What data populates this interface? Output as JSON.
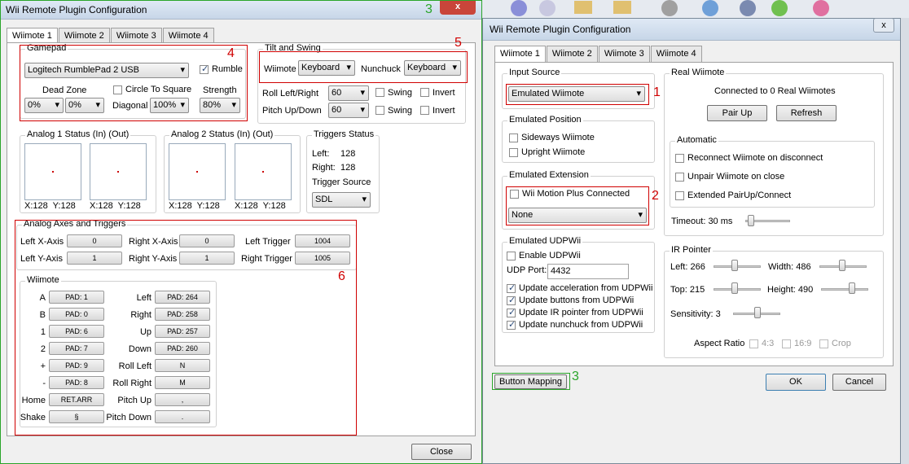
{
  "left_window": {
    "title": "Wii Remote Plugin Configuration",
    "close_glyph": "x",
    "tabs": [
      "Wiimote 1",
      "Wiimote 2",
      "Wiimote 3",
      "Wiimote 4"
    ],
    "gamepad": {
      "label": "Gamepad",
      "device": "Logitech RumblePad 2 USB",
      "rumble": "Rumble",
      "dead_zone": "Dead Zone",
      "dz1": "0%",
      "dz2": "0%",
      "circle_to_square": "Circle To Square",
      "diagonal": "Diagonal",
      "diagonal_value": "100%",
      "strength": "Strength",
      "strength_value": "80%"
    },
    "tilt": {
      "label": "Tilt and Swing",
      "wiimote": "Wiimote",
      "wiimote_value": "Keyboard",
      "nunchuck": "Nunchuck",
      "nunchuck_value": "Keyboard",
      "roll": "Roll Left/Right",
      "roll_value": "60",
      "pitch": "Pitch Up/Down",
      "pitch_value": "60",
      "swing": "Swing",
      "invert": "Invert"
    },
    "analog1": {
      "label": "Analog 1 Status (In) (Out)",
      "in": "X:128  Y:128",
      "out": "X:128  Y:128"
    },
    "analog2": {
      "label": "Analog 2 Status (In) (Out)",
      "in": "X:128  Y:128",
      "out": "X:128  Y:128"
    },
    "triggers": {
      "label": "Triggers Status",
      "left": "Left:",
      "left_value": "128",
      "right": "Right:",
      "right_value": "128",
      "source": "Trigger Source",
      "source_value": "SDL"
    },
    "axes": {
      "label": "Analog Axes and Triggers",
      "left_x": "Left X-Axis",
      "left_x_value": "0",
      "left_y": "Left Y-Axis",
      "left_y_value": "1",
      "right_x": "Right X-Axis",
      "right_x_value": "0",
      "right_y": "Right Y-Axis",
      "right_y_value": "1",
      "left_trigger": "Left Trigger",
      "left_trigger_value": "1004",
      "right_trigger": "Right Trigger",
      "right_trigger_value": "1005"
    },
    "wiimote": {
      "label": "Wiimote",
      "left_col": [
        {
          "label": "A",
          "value": "PAD: 1"
        },
        {
          "label": "B",
          "value": "PAD: 0"
        },
        {
          "label": "1",
          "value": "PAD: 6"
        },
        {
          "label": "2",
          "value": "PAD: 7"
        },
        {
          "label": "+",
          "value": "PAD: 9"
        },
        {
          "label": "-",
          "value": "PAD: 8"
        },
        {
          "label": "Home",
          "value": "RET.ARR"
        },
        {
          "label": "Shake",
          "value": "§"
        }
      ],
      "right_col": [
        {
          "label": "Left",
          "value": "PAD: 264"
        },
        {
          "label": "Right",
          "value": "PAD: 258"
        },
        {
          "label": "Up",
          "value": "PAD: 257"
        },
        {
          "label": "Down",
          "value": "PAD: 260"
        },
        {
          "label": "Roll Left",
          "value": "N"
        },
        {
          "label": "Roll Right",
          "value": "M"
        },
        {
          "label": "Pitch Up",
          "value": ","
        },
        {
          "label": "Pitch Down",
          "value": "."
        }
      ]
    },
    "close_button": "Close"
  },
  "right_window": {
    "title": "Wii Remote Plugin Configuration",
    "close_glyph": "x",
    "tabs": [
      "Wiimote 1",
      "Wiimote 2",
      "Wiimote 3",
      "Wiimote 4"
    ],
    "input_source": {
      "label": "Input Source",
      "value": "Emulated Wiimote"
    },
    "position": {
      "label": "Emulated Position",
      "sideways": "Sideways Wiimote",
      "upright": "Upright Wiimote"
    },
    "extension": {
      "label": "Emulated Extension",
      "motion_plus": "Wii Motion Plus Connected",
      "value": "None"
    },
    "udp": {
      "label": "Emulated UDPWii",
      "enable": "Enable UDPWii",
      "port_label": "UDP Port:",
      "port_value": "4432",
      "accel": "Update acceleration from UDPWii",
      "buttons": "Update buttons from UDPWii",
      "ir": "Update IR pointer from UDPWii",
      "nunchuck": "Update nunchuck from UDPWii"
    },
    "real": {
      "label": "Real Wiimote",
      "status": "Connected to 0 Real Wiimotes",
      "pair": "Pair Up",
      "refresh": "Refresh"
    },
    "automatic": {
      "label": "Automatic",
      "reconnect": "Reconnect Wiimote on disconnect",
      "unpair": "Unpair Wiimote on close",
      "extended": "Extended PairUp/Connect"
    },
    "timeout": "Timeout: 30 ms",
    "ir": {
      "label": "IR Pointer",
      "left": "Left: 266",
      "width": "Width: 486",
      "top": "Top: 215",
      "height": "Height: 490",
      "sensitivity": "Sensitivity: 3",
      "aspect": "Aspect Ratio",
      "r43": "4:3",
      "r169": "16:9",
      "crop": "Crop"
    },
    "button_mapping": "Button Mapping",
    "ok": "OK",
    "cancel": "Cancel"
  },
  "annotations": {
    "n1": "1",
    "n2": "2",
    "n3": "3",
    "n4": "4",
    "n5": "5",
    "n6": "6"
  },
  "colors": {
    "annotation_red": "#d00000",
    "annotation_green": "#2aa52a"
  }
}
